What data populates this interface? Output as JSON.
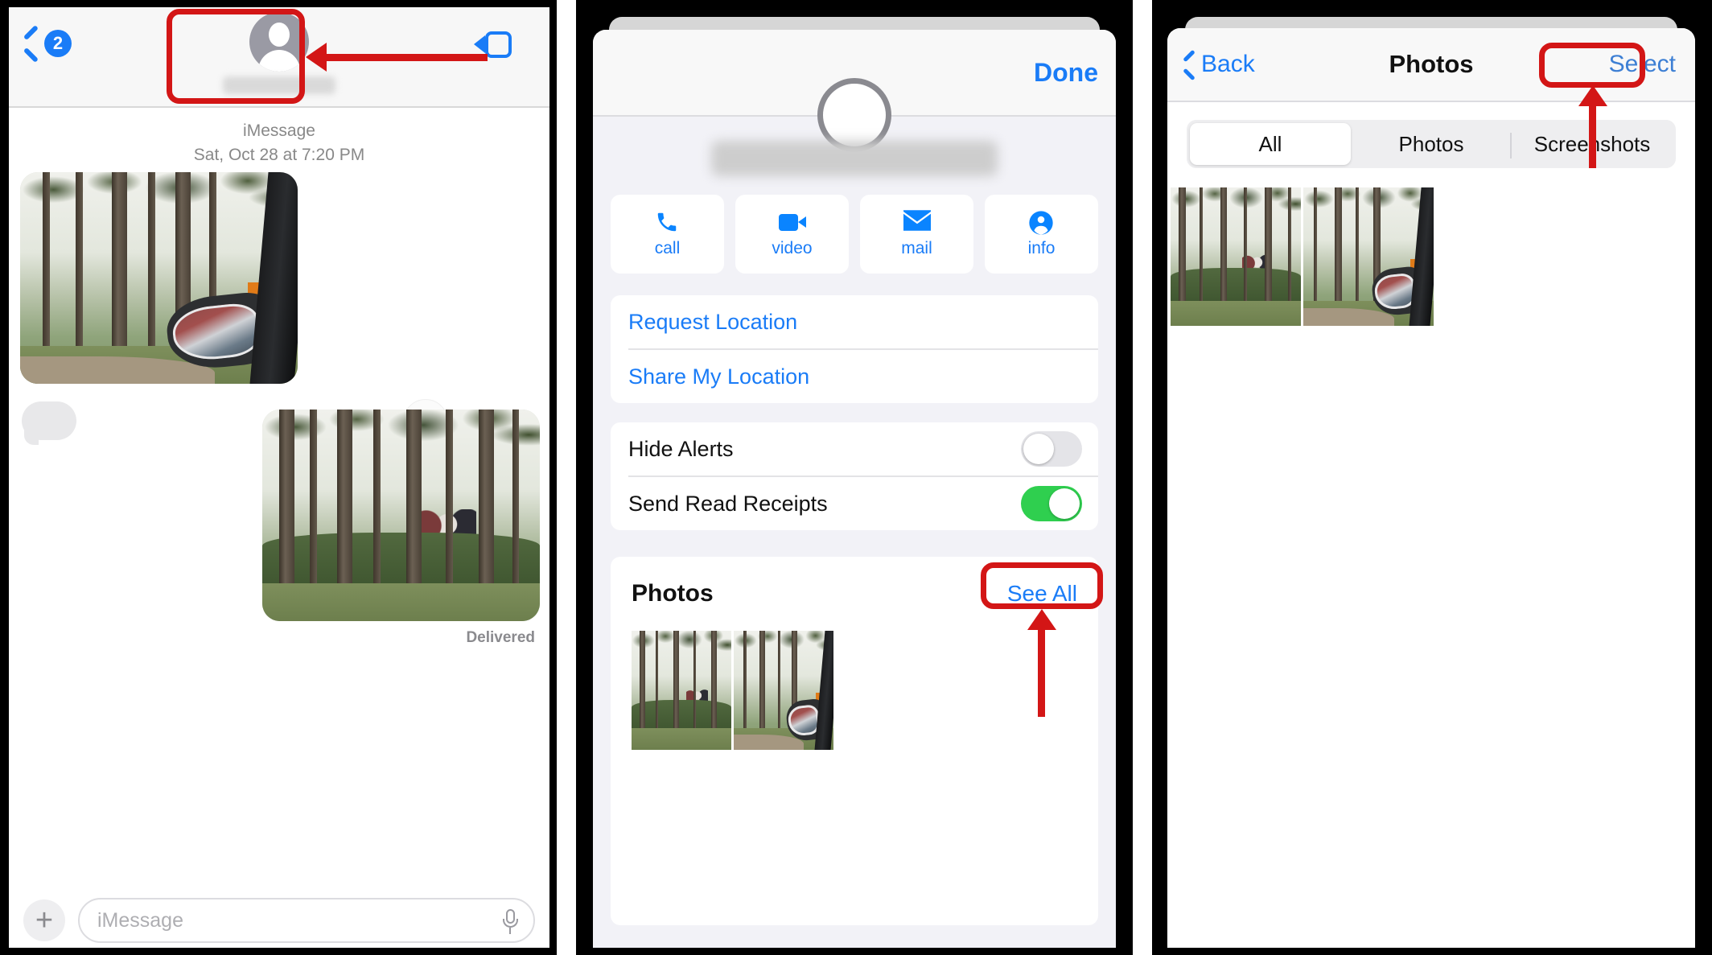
{
  "panels": [
    {
      "id": "conversation",
      "header": {
        "back_badge": "2",
        "back_icon": "chevron-left-icon",
        "video_icon": "video-camera-icon",
        "contact_name_blurred": ""
      },
      "thread": {
        "service": "iMessage",
        "timestamp": "Sat, Oct 28 at 7:20 PM",
        "incoming_photo_alt": "Forest with pine trees seen past a car side mirror",
        "outgoing_photo_alt": "Pine tree trunks with hedge and people in the distance",
        "save_icon": "download-icon",
        "status": "Delivered"
      },
      "composer": {
        "plus_icon": "plus-icon",
        "placeholder": "iMessage",
        "value": "",
        "mic_icon": "microphone-icon"
      }
    },
    {
      "id": "contact-details",
      "navbar": {
        "done_label": "Done"
      },
      "contact": {
        "name_blurred": ""
      },
      "actions": [
        {
          "icon": "phone-icon",
          "label": "call"
        },
        {
          "icon": "video-camera-icon",
          "label": "video"
        },
        {
          "icon": "mail-icon",
          "label": "mail"
        },
        {
          "icon": "person-circle-icon",
          "label": "info"
        }
      ],
      "location": [
        {
          "label": "Request Location"
        },
        {
          "label": "Share My Location"
        }
      ],
      "toggles": [
        {
          "label": "Hide Alerts",
          "state": "off"
        },
        {
          "label": "Send Read Receipts",
          "state": "on"
        }
      ],
      "photos_section": {
        "title": "Photos",
        "see_all_label": "See All",
        "thumb_count": 2
      }
    },
    {
      "id": "photos-grid",
      "navbar": {
        "back_label": "Back",
        "back_icon": "chevron-left-icon",
        "title": "Photos",
        "select_label": "Select"
      },
      "segments": [
        {
          "label": "All",
          "active": true
        },
        {
          "label": "Photos",
          "active": false
        },
        {
          "label": "Screenshots",
          "active": false
        }
      ],
      "grid_count": 2
    }
  ],
  "annotations": {
    "highlight_color": "#d31616",
    "targets": [
      "contact-header-button",
      "see-all-button",
      "select-button"
    ]
  },
  "colors": {
    "accent_blue": "#1a7cf7",
    "toggle_on_green": "#2fcf4f",
    "annotation_red": "#d31616"
  }
}
